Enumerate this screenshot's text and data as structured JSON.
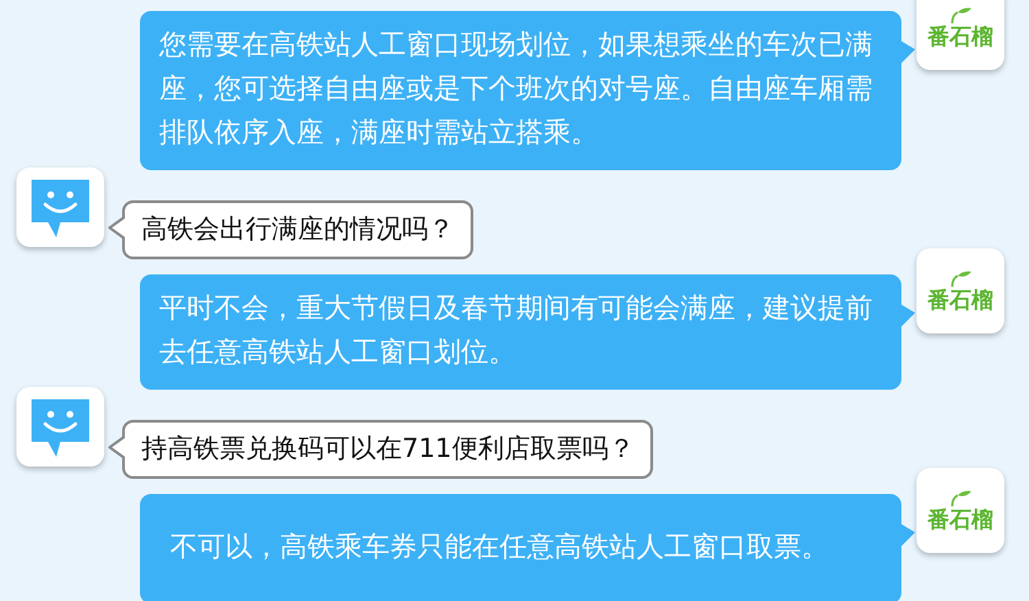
{
  "messages": [
    {
      "kind": "bot",
      "avatar_label": "番石榴",
      "text": "您需要在高铁站人工窗口现场划位，如果想乘坐的车次已满座，您可选择自由座或是下个班次的对号座。自由座车厢需排队依序入座，满座时需站立搭乘。"
    },
    {
      "kind": "user",
      "text": "高铁会出行满座的情况吗？"
    },
    {
      "kind": "bot",
      "avatar_label": "番石榴",
      "text": "平时不会，重大节假日及春节期间有可能会满座，建议提前去任意高铁站人工窗口划位。"
    },
    {
      "kind": "user",
      "text": "持高铁票兑换码可以在711便利店取票吗？"
    },
    {
      "kind": "bot",
      "avatar_label": "番石榴",
      "text": "不可以，高铁乘车券只能在任意高铁站人工窗口取票。"
    }
  ]
}
